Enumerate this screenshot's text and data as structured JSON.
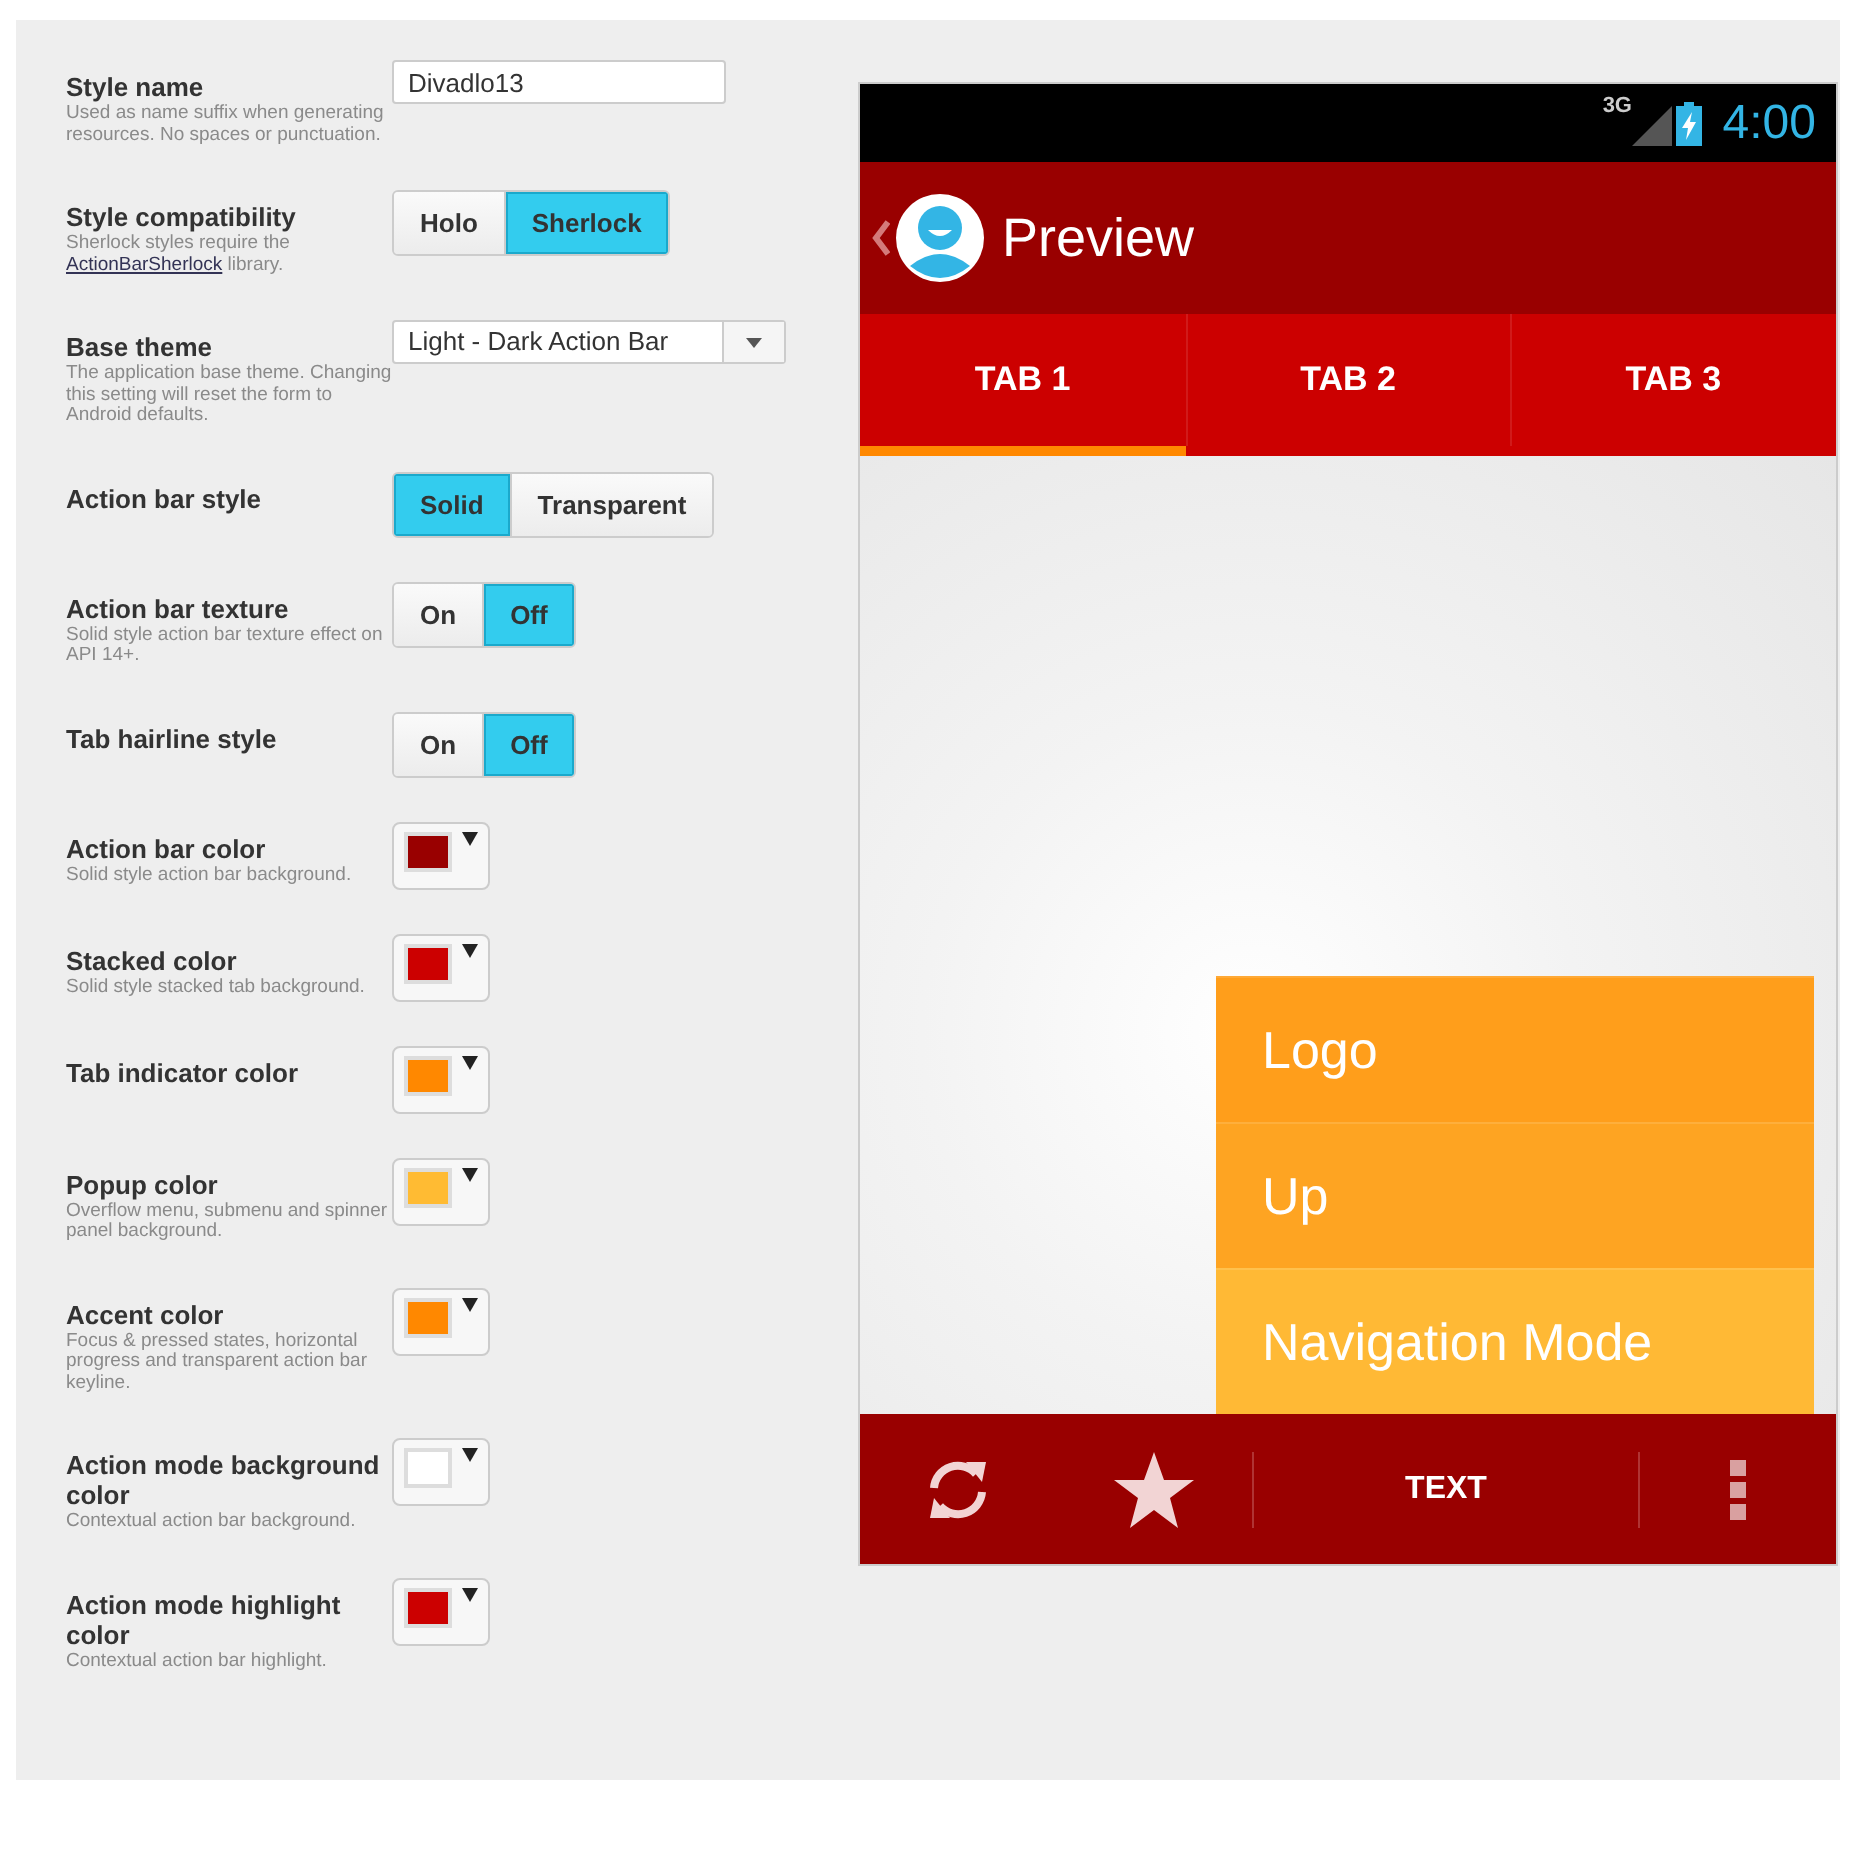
{
  "settings": [
    {
      "kind": "text",
      "label": "Style name",
      "description": "Used as name suffix when generating resources. No spaces or punctuation.",
      "value": "Divadlo13"
    },
    {
      "kind": "segmented",
      "label": "Style compatibility",
      "description": "Sherlock styles require the",
      "link": "ActionBarSherlock",
      "description_after": "library.",
      "options": [
        {
          "label": "Holo",
          "selected": false
        },
        {
          "label": "Sherlock",
          "selected": true
        }
      ]
    },
    {
      "kind": "select",
      "label": "Base theme",
      "description": "The application base theme. Changing this setting will reset the form to Android defaults.",
      "value": "Light - Dark Action Bar"
    },
    {
      "kind": "segmented",
      "label": "Action bar style",
      "options": [
        {
          "label": "Solid",
          "selected": true
        },
        {
          "label": "Transparent",
          "selected": false
        }
      ]
    },
    {
      "kind": "segmented",
      "label": "Action bar texture",
      "description": "Solid style action bar texture effect on API 14+.",
      "options": [
        {
          "label": "On",
          "selected": false
        },
        {
          "label": "Off",
          "selected": true
        }
      ]
    },
    {
      "kind": "segmented",
      "label": "Tab hairline style",
      "options": [
        {
          "label": "On",
          "selected": false
        },
        {
          "label": "Off",
          "selected": true
        }
      ]
    },
    {
      "kind": "color",
      "label": "Action bar color",
      "description": "Solid style action bar background.",
      "color": "#990000"
    },
    {
      "kind": "color",
      "label": "Stacked color",
      "description": "Solid style stacked tab background.",
      "color": "#cc0000"
    },
    {
      "kind": "color",
      "label": "Tab indicator color",
      "color": "#ff8800"
    },
    {
      "kind": "color",
      "label": "Popup color",
      "description": "Overflow menu, submenu and spinner panel background.",
      "color": "#ffbb33"
    },
    {
      "kind": "color",
      "label": "Accent color",
      "description": "Focus & pressed states, horizontal progress and transparent action bar keyline.",
      "color": "#ff8800"
    },
    {
      "kind": "color",
      "label": "Action mode background color",
      "description": "Contextual action bar background.",
      "color": "#ffffff"
    },
    {
      "kind": "color",
      "label": "Action mode highlight color",
      "description": "Contextual action bar highlight.",
      "color": "#cc0000"
    }
  ],
  "preview": {
    "status_bar": {
      "network": "3G",
      "time": "4:00"
    },
    "action_bar": {
      "title": "Preview"
    },
    "tabs": [
      {
        "label": "TAB 1",
        "selected": true
      },
      {
        "label": "TAB 2",
        "selected": false
      },
      {
        "label": "TAB 3",
        "selected": false
      }
    ],
    "popup_menu": [
      {
        "label": "Logo",
        "color": "#ff9e1b"
      },
      {
        "label": "Up",
        "color": "#fea422"
      },
      {
        "label": "Navigation Mode",
        "color": "#ffb935"
      }
    ],
    "bottom_bar": {
      "text": "TEXT"
    }
  }
}
